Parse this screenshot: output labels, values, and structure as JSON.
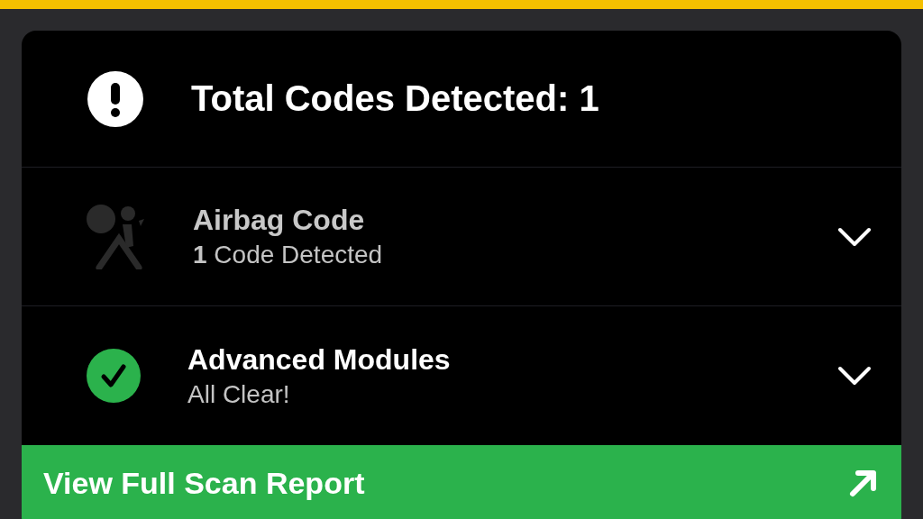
{
  "summary": {
    "title": "Total Codes Detected: 1"
  },
  "modules": [
    {
      "kind": "airbag",
      "title": "Airbag Code",
      "subtitle": "**1** Code Detected",
      "fault": true,
      "expanded": false
    },
    {
      "kind": "check",
      "title": "Advanced Modules",
      "subtitle": "All Clear!",
      "fault": false,
      "expanded": false
    }
  ],
  "report_button": {
    "label": "View Full Scan Report"
  }
}
